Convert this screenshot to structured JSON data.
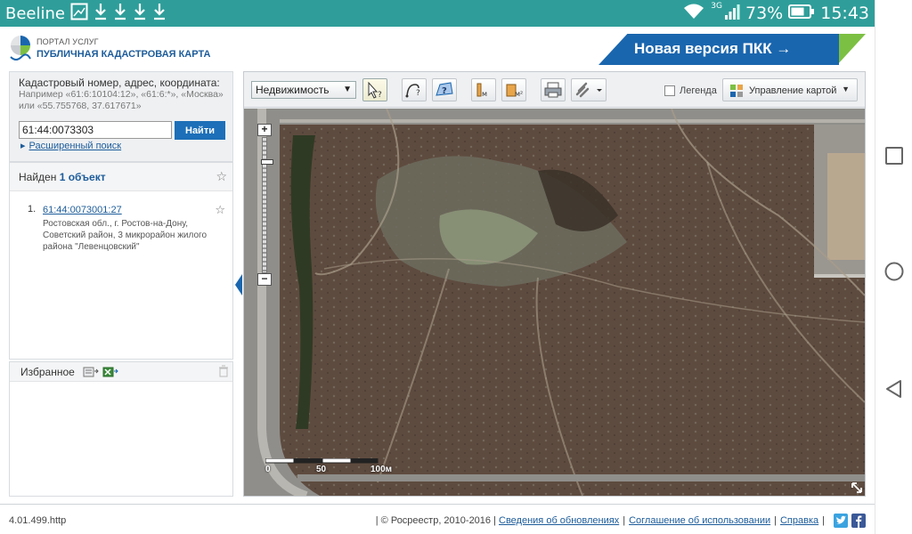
{
  "status_bar": {
    "carrier": "Beeline",
    "network_type": "3G",
    "battery": "73%",
    "time": "15:43"
  },
  "header": {
    "portal_label": "ПОРТАЛ УСЛУГ",
    "title": "ПУБЛИЧНАЯ КАДАСТРОВАЯ КАРТА",
    "banner_text": "Новая версия ПКК →"
  },
  "search": {
    "label": "Кадастровый номер, адрес, координата:",
    "hint": "Например «61:6:10104:12», «61:6:*», «Москва» или «55.755768, 37.617671»",
    "value": "61:44:0073303",
    "button_label": "Найти",
    "advanced_link": "Расширенный поиск"
  },
  "results": {
    "header_prefix": "Найден",
    "count_text": "1 объект",
    "items": [
      {
        "number": "1.",
        "cadastral_number": "61:44:0073001:27",
        "address": "Ростовская обл., г. Ростов-на-Дону, Советский район, 3 микрорайон жилого района \"Левенцовский\""
      }
    ]
  },
  "favorites": {
    "title": "Избранное"
  },
  "map_toolbar": {
    "layer_selected": "Недвижимость",
    "legend_label": "Легенда",
    "map_control_label": "Управление картой"
  },
  "map": {
    "zoom_in": "+",
    "zoom_out": "−",
    "scale_labels": [
      "0",
      "50",
      "100м"
    ]
  },
  "footer": {
    "version": "4.01.499.http",
    "copyright": "| © Росреестр, 2010-2016 |",
    "links": [
      "Сведения об обновлениях",
      "Соглашение об использовании",
      "Справка"
    ]
  },
  "colors": {
    "status_bar": "#2f9e9a",
    "brand_blue": "#1a66ae",
    "brand_green": "#7cc043",
    "link": "#1c5c9a",
    "search_button": "#1c6fb8"
  }
}
